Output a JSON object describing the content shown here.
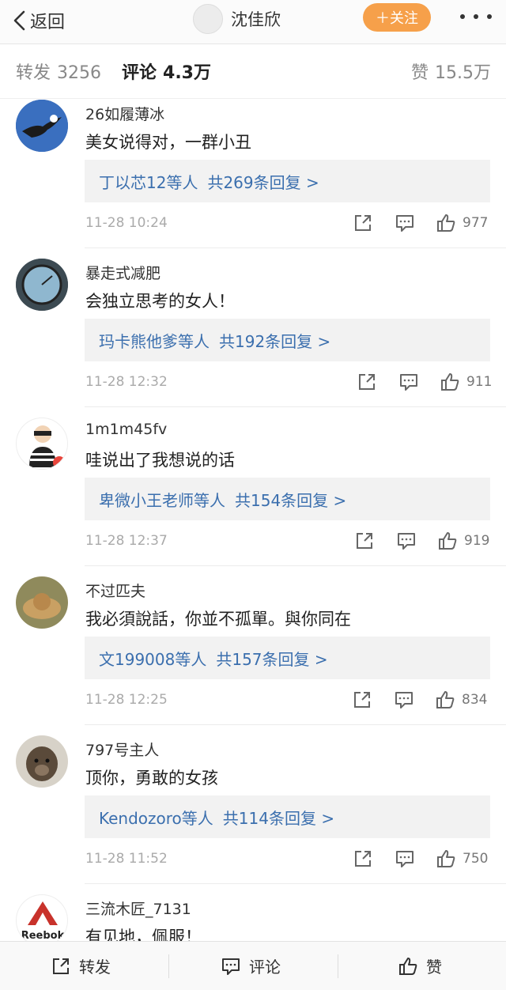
{
  "header": {
    "back_label": "返回",
    "title": "沈佳欣",
    "follow_label": "＋关注"
  },
  "stats": {
    "repost_label": "转发",
    "repost_count": "3256",
    "comment_label": "评论",
    "comment_count": "4.3万",
    "like_label": "赞",
    "like_count": "15.5万"
  },
  "comments": [
    {
      "name": "26如履薄冰",
      "text": "美女说得对，一群小丑",
      "reply_who": "丁以芯12等人",
      "reply_total": "共269条回复 >",
      "time": "11-28 10:24",
      "likes": "977"
    },
    {
      "name": "暴走式减肥",
      "text": "会独立思考的女人！",
      "reply_who": "玛卡熊他爹等人",
      "reply_total": "共192条回复 >",
      "time": "11-28 12:32",
      "likes": "911"
    },
    {
      "name": "1m1m45fv",
      "text": "哇说出了我想说的话",
      "reply_who": "卑微小王老师等人",
      "reply_total": "共154条回复 >",
      "time": "11-28 12:37",
      "likes": "919"
    },
    {
      "name": "不过匹夫",
      "text": "我必須說話，你並不孤單。與你同在",
      "reply_who": "文199008等人",
      "reply_total": "共157条回复 >",
      "time": "11-28 12:25",
      "likes": "834"
    },
    {
      "name": "797号主人",
      "text": "顶你，勇敢的女孩",
      "reply_who": "Kendozoro等人",
      "reply_total": "共114条回复 >",
      "time": "11-28 11:52",
      "likes": "750"
    },
    {
      "name": "三流木匠_7131",
      "text": "有见地，佩服！",
      "avatar_logo_text": "Reebok"
    }
  ],
  "bottom": {
    "repost_label": "转发",
    "comment_label": "评论",
    "like_label": "赞"
  },
  "colors": {
    "accent_orange": "#f6a04a",
    "link_blue": "#3b6fae"
  }
}
